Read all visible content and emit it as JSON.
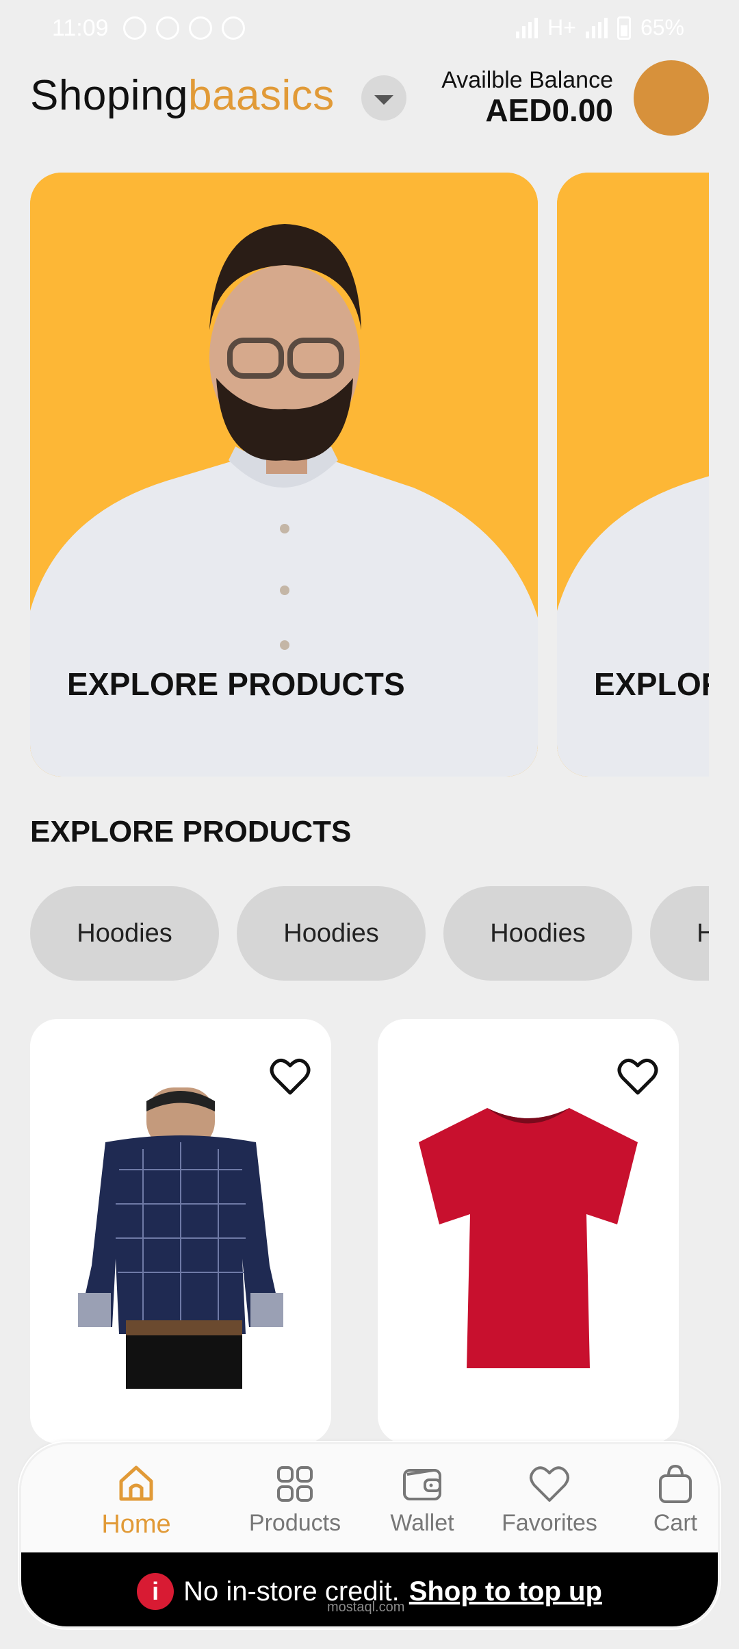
{
  "status_bar": {
    "time": "11:09",
    "battery": "65%",
    "network": "H+"
  },
  "header": {
    "brand_part1": "Shoping",
    "brand_part2": "baasics",
    "balance_label": "Availble Balance",
    "balance_value": "AED0.00",
    "colors": {
      "accent": "#e19a37",
      "avatar": "#d7913b"
    }
  },
  "banners": [
    {
      "title": "EXPLORE PRODUCTS"
    },
    {
      "title": "EXPLORE PRODUCTS"
    }
  ],
  "section": {
    "title": "EXPLORE PRODUCTS"
  },
  "chips": [
    "Hoodies",
    "Hoodies",
    "Hoodies",
    "Hoodies"
  ],
  "products": [
    {
      "image": "navy-checked-shirt",
      "favorite_icon": "heart-outline-icon"
    },
    {
      "image": "red-tshirt",
      "favorite_icon": "heart-outline-icon"
    }
  ],
  "nav": {
    "items": [
      {
        "label": "Home",
        "icon": "home-icon",
        "active": true
      },
      {
        "label": "Products",
        "icon": "grid-icon",
        "active": false
      },
      {
        "label": "Wallet",
        "icon": "wallet-icon",
        "active": false
      },
      {
        "label": "Favorites",
        "icon": "heart-icon",
        "active": false
      },
      {
        "label": "Cart",
        "icon": "bag-icon",
        "active": false
      }
    ]
  },
  "credit_bar": {
    "message": "No in-store credit.",
    "link": "Shop to top up",
    "info_icon": "i"
  },
  "watermark": "mostaql.com"
}
